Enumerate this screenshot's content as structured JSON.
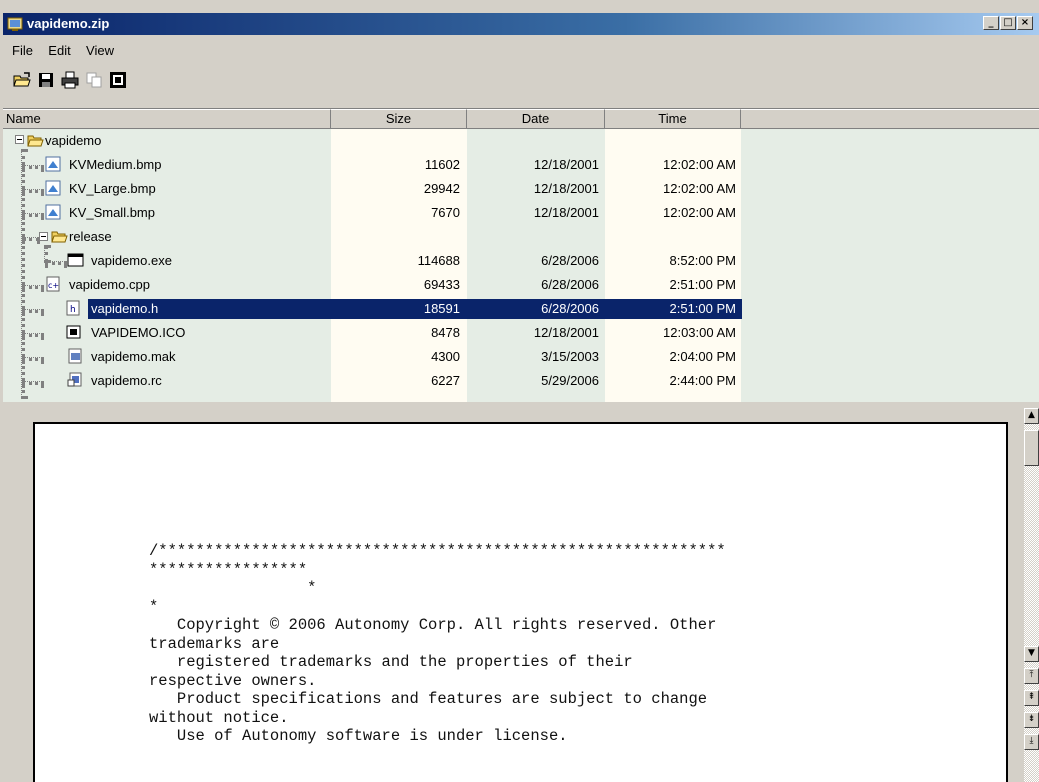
{
  "window": {
    "title": "vapidemo.zip",
    "minimize_label": "_",
    "maximize_label": "□",
    "close_label": "×"
  },
  "menu": {
    "file": "File",
    "edit": "Edit",
    "view": "View"
  },
  "toolbar": {
    "buttons": [
      "open-folder-icon",
      "save-icon",
      "print-icon",
      "copy-icon",
      "properties-icon"
    ]
  },
  "columns": {
    "name": "Name",
    "size": "Size",
    "date": "Date",
    "time": "Time"
  },
  "tree": {
    "root_folder": "vapidemo",
    "subfolder": "release",
    "rows": [
      {
        "name": "KVMedium.bmp",
        "size": "11602",
        "date": "12/18/2001",
        "time": "12:02:00 AM",
        "icon": "bitmap-icon"
      },
      {
        "name": "KV_Large.bmp",
        "size": "29942",
        "date": "12/18/2001",
        "time": "12:02:00 AM",
        "icon": "bitmap-icon"
      },
      {
        "name": "KV_Small.bmp",
        "size": "7670",
        "date": "12/18/2001",
        "time": "12:02:00 AM",
        "icon": "bitmap-icon"
      },
      {
        "name": "vapidemo.exe",
        "size": "114688",
        "date": "6/28/2006",
        "time": "8:52:00 PM",
        "icon": "exe-icon"
      },
      {
        "name": "vapidemo.cpp",
        "size": "69433",
        "date": "6/28/2006",
        "time": "2:51:00 PM",
        "icon": "cpp-file-icon"
      },
      {
        "name": "vapidemo.h",
        "size": "18591",
        "date": "6/28/2006",
        "time": "2:51:00 PM",
        "icon": "header-file-icon",
        "selected": true
      },
      {
        "name": "VAPIDEMO.ICO",
        "size": "8478",
        "date": "12/18/2001",
        "time": "12:03:00 AM",
        "icon": "ico-file-icon"
      },
      {
        "name": "vapidemo.mak",
        "size": "4300",
        "date": "3/15/2003",
        "time": "2:04:00 PM",
        "icon": "makefile-icon"
      },
      {
        "name": "vapidemo.rc",
        "size": "6227",
        "date": "5/29/2006",
        "time": "2:44:00 PM",
        "icon": "resource-file-icon"
      }
    ]
  },
  "preview": {
    "lines": [
      "/*************************************************************",
      "*****************",
      "                 *",
      "*",
      "   Copyright © 2006 Autonomy Corp. All rights reserved. Other",
      "trademarks are",
      "   registered trademarks and the properties of their",
      "respective owners.",
      "   Product specifications and features are subject to change",
      "without notice.",
      "   Use of Autonomy software is under license."
    ]
  },
  "colors": {
    "selection": "#0a246a",
    "titlebar_start": "#0a246a",
    "titlebar_end": "#a6caf0",
    "size_column_bg": "#fffcf2",
    "time_column_bg": "#fffcf2",
    "alt_column_bg": "#e5ede5"
  }
}
